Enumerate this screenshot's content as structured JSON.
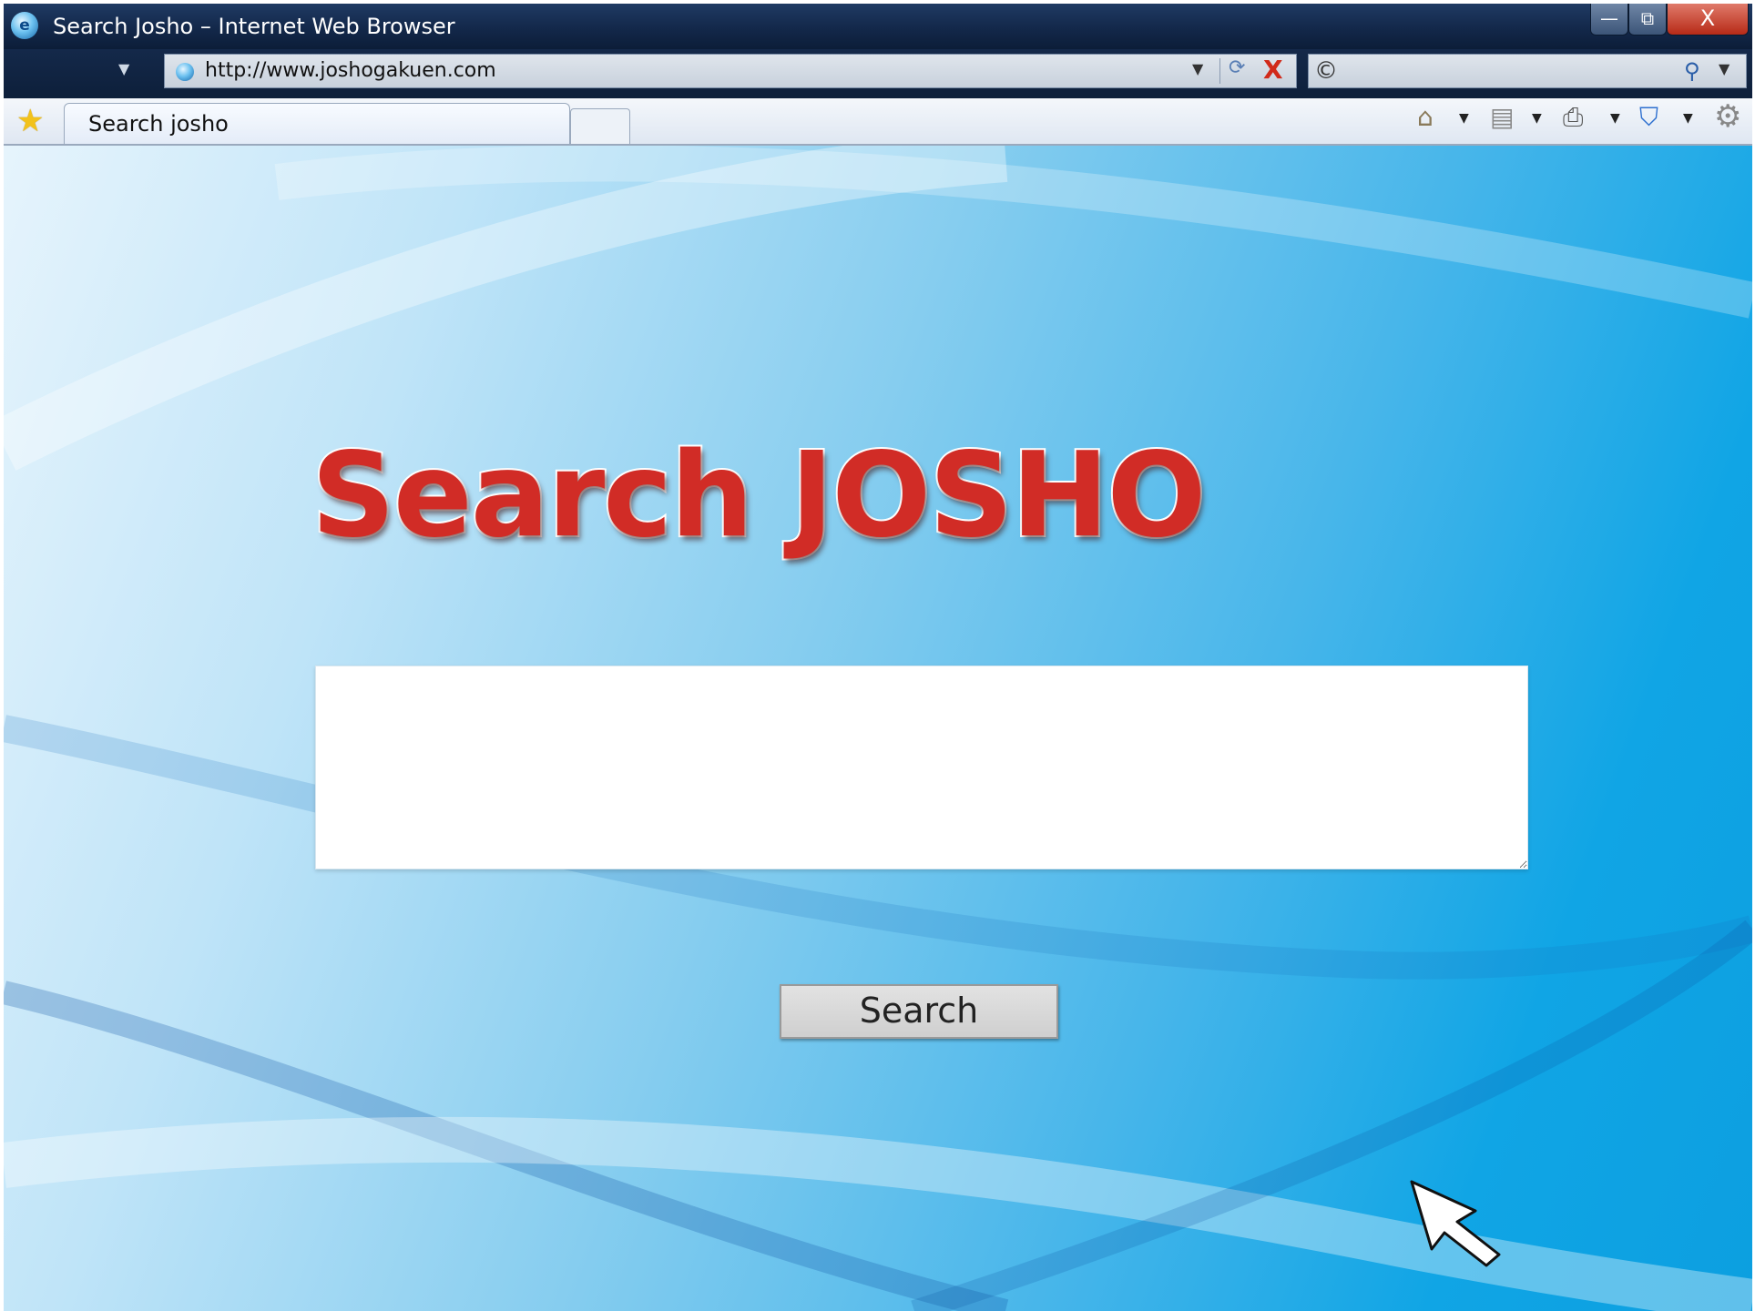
{
  "window": {
    "title": "Search Josho – Internet Web Browser",
    "controls": {
      "minimize": "—",
      "maximize": "⧉",
      "close": "X"
    }
  },
  "address_bar": {
    "url": "http://www.joshogakuen.com"
  },
  "tabs": [
    {
      "label": "Search josho",
      "active": true
    }
  ],
  "toolbar": {
    "icons": [
      "home-icon",
      "feeds-icon",
      "print-icon",
      "safety-icon",
      "gear-icon"
    ]
  },
  "page": {
    "heading": "Search JOSHO",
    "query_value": "",
    "search_button_label": "Search"
  },
  "colors": {
    "heading_red": "#d12c26",
    "background_blue": "#10a5e5",
    "titlebar_navy": "#13284a"
  }
}
